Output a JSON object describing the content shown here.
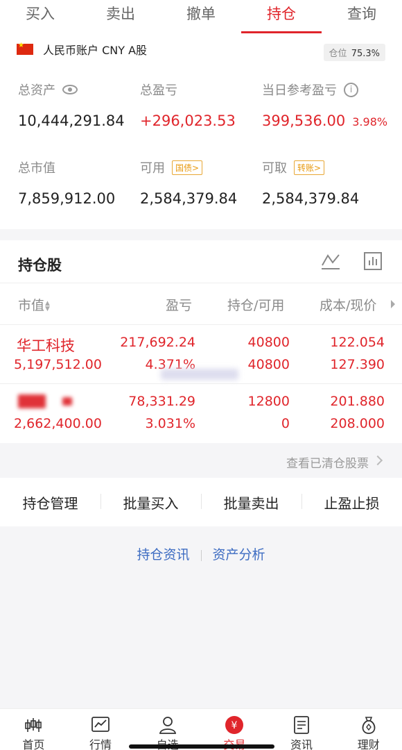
{
  "tabs": [
    {
      "label": "买入"
    },
    {
      "label": "卖出"
    },
    {
      "label": "撤单"
    },
    {
      "label": "持仓"
    },
    {
      "label": "查询"
    }
  ],
  "account": {
    "name": "人民币账户 CNY A股",
    "position_label": "仓位",
    "position_value": "75.3%",
    "total_assets_label": "总资产",
    "total_assets": "10,444,291.84",
    "total_pnl_label": "总盈亏",
    "total_pnl": "+296,023.53",
    "daily_pnl_label": "当日参考盈亏",
    "daily_pnl": "399,536.00",
    "daily_pnl_pct": "3.98%",
    "market_value_label": "总市值",
    "market_value": "7,859,912.00",
    "available_label": "可用",
    "available_tag": "国债>",
    "available": "2,584,379.84",
    "withdrawable_label": "可取",
    "withdrawable_tag": "转账>",
    "withdrawable": "2,584,379.84"
  },
  "holdings": {
    "title": "持仓股",
    "columns": {
      "market_value": "市值",
      "pnl": "盈亏",
      "position": "持仓/可用",
      "cost": "成本/现价"
    },
    "rows": [
      {
        "name": "华工科技",
        "market_value": "5,197,512.00",
        "pnl": "217,692.24",
        "pnl_pct": "4.371%",
        "position": "40800",
        "available": "40800",
        "cost": "122.054",
        "price": "127.390"
      },
      {
        "name": "",
        "market_value": "2,662,400.00",
        "pnl": "78,331.29",
        "pnl_pct": "3.031%",
        "position": "12800",
        "available": "0",
        "cost": "201.880",
        "price": "208.000"
      }
    ]
  },
  "cleared_link": "查看已清仓股票",
  "actions": [
    {
      "label": "持仓管理"
    },
    {
      "label": "批量买入"
    },
    {
      "label": "批量卖出"
    },
    {
      "label": "止盈止损"
    }
  ],
  "links": {
    "news": "持仓资讯",
    "analysis": "资产分析"
  },
  "bottom_nav": [
    {
      "label": "首页"
    },
    {
      "label": "行情"
    },
    {
      "label": "自选"
    },
    {
      "label": "交易"
    },
    {
      "label": "资讯"
    },
    {
      "label": "理财"
    }
  ],
  "colors": {
    "accent": "#e0252b",
    "link": "#3d6cc2",
    "tag": "#e89a10"
  }
}
